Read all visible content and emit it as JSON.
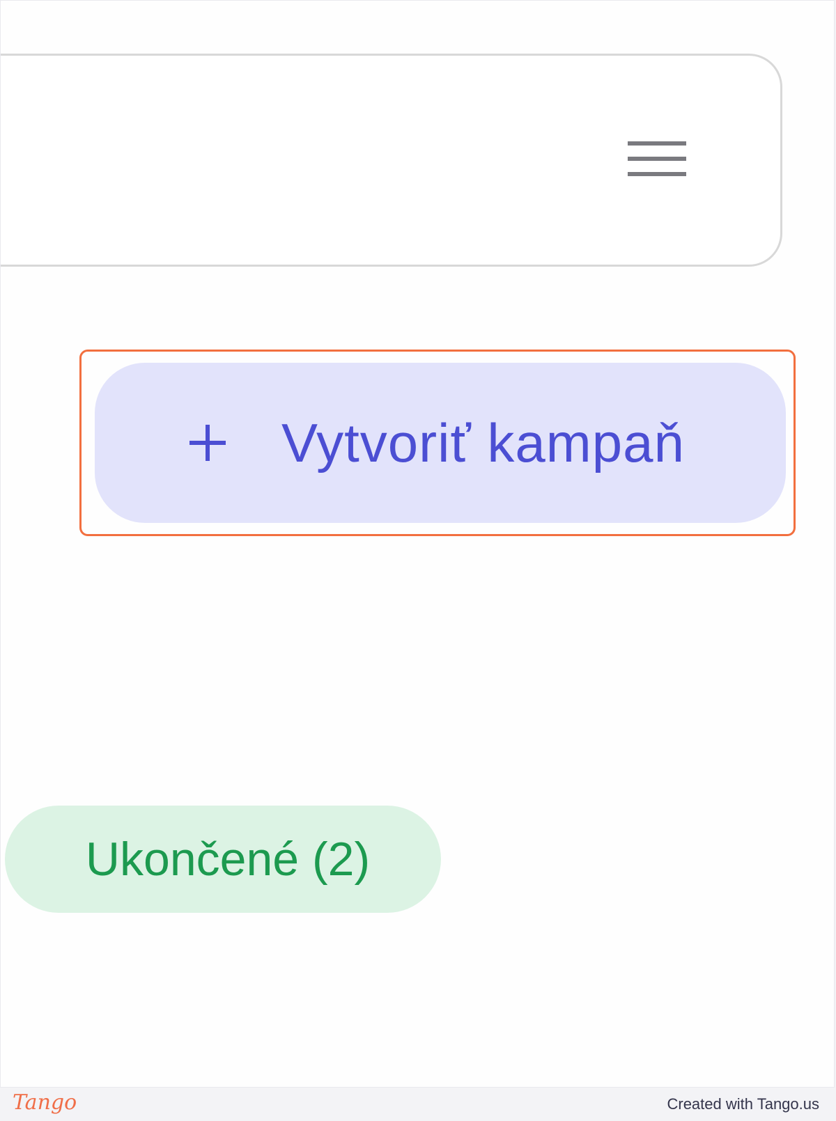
{
  "toolbar": {
    "menu_icon": "hamburger-menu-icon"
  },
  "create_campaign": {
    "icon": "plus-icon",
    "label": "Vytvoriť kampaň"
  },
  "status_filter": {
    "label": "Ukončené (2)"
  },
  "footer": {
    "logo": "Tango",
    "credit": "Created with Tango.us"
  },
  "colors": {
    "highlight": "#f26f3f",
    "create_button_bg": "#e2e3fb",
    "create_button_fg": "#4b4ed3",
    "status_pill_bg": "#dcf3e4",
    "status_pill_fg": "#1c9a4f",
    "tango_brand": "#f06e48"
  }
}
